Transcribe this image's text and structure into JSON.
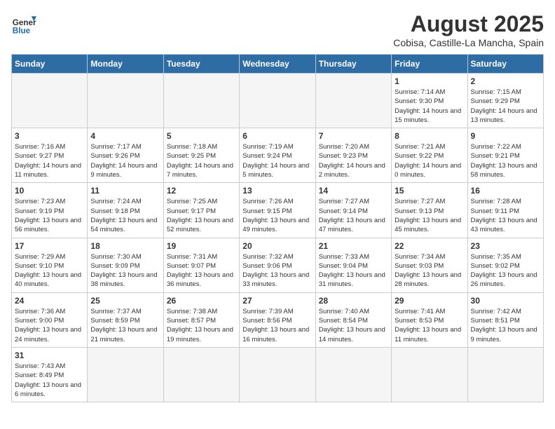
{
  "header": {
    "logo_general": "General",
    "logo_blue": "Blue",
    "month_title": "August 2025",
    "subtitle": "Cobisa, Castille-La Mancha, Spain"
  },
  "weekdays": [
    "Sunday",
    "Monday",
    "Tuesday",
    "Wednesday",
    "Thursday",
    "Friday",
    "Saturday"
  ],
  "weeks": [
    [
      {
        "day": "",
        "info": ""
      },
      {
        "day": "",
        "info": ""
      },
      {
        "day": "",
        "info": ""
      },
      {
        "day": "",
        "info": ""
      },
      {
        "day": "",
        "info": ""
      },
      {
        "day": "1",
        "info": "Sunrise: 7:14 AM\nSunset: 9:30 PM\nDaylight: 14 hours and 15 minutes."
      },
      {
        "day": "2",
        "info": "Sunrise: 7:15 AM\nSunset: 9:29 PM\nDaylight: 14 hours and 13 minutes."
      }
    ],
    [
      {
        "day": "3",
        "info": "Sunrise: 7:16 AM\nSunset: 9:27 PM\nDaylight: 14 hours and 11 minutes."
      },
      {
        "day": "4",
        "info": "Sunrise: 7:17 AM\nSunset: 9:26 PM\nDaylight: 14 hours and 9 minutes."
      },
      {
        "day": "5",
        "info": "Sunrise: 7:18 AM\nSunset: 9:25 PM\nDaylight: 14 hours and 7 minutes."
      },
      {
        "day": "6",
        "info": "Sunrise: 7:19 AM\nSunset: 9:24 PM\nDaylight: 14 hours and 5 minutes."
      },
      {
        "day": "7",
        "info": "Sunrise: 7:20 AM\nSunset: 9:23 PM\nDaylight: 14 hours and 2 minutes."
      },
      {
        "day": "8",
        "info": "Sunrise: 7:21 AM\nSunset: 9:22 PM\nDaylight: 14 hours and 0 minutes."
      },
      {
        "day": "9",
        "info": "Sunrise: 7:22 AM\nSunset: 9:21 PM\nDaylight: 13 hours and 58 minutes."
      }
    ],
    [
      {
        "day": "10",
        "info": "Sunrise: 7:23 AM\nSunset: 9:19 PM\nDaylight: 13 hours and 56 minutes."
      },
      {
        "day": "11",
        "info": "Sunrise: 7:24 AM\nSunset: 9:18 PM\nDaylight: 13 hours and 54 minutes."
      },
      {
        "day": "12",
        "info": "Sunrise: 7:25 AM\nSunset: 9:17 PM\nDaylight: 13 hours and 52 minutes."
      },
      {
        "day": "13",
        "info": "Sunrise: 7:26 AM\nSunset: 9:15 PM\nDaylight: 13 hours and 49 minutes."
      },
      {
        "day": "14",
        "info": "Sunrise: 7:27 AM\nSunset: 9:14 PM\nDaylight: 13 hours and 47 minutes."
      },
      {
        "day": "15",
        "info": "Sunrise: 7:27 AM\nSunset: 9:13 PM\nDaylight: 13 hours and 45 minutes."
      },
      {
        "day": "16",
        "info": "Sunrise: 7:28 AM\nSunset: 9:11 PM\nDaylight: 13 hours and 43 minutes."
      }
    ],
    [
      {
        "day": "17",
        "info": "Sunrise: 7:29 AM\nSunset: 9:10 PM\nDaylight: 13 hours and 40 minutes."
      },
      {
        "day": "18",
        "info": "Sunrise: 7:30 AM\nSunset: 9:09 PM\nDaylight: 13 hours and 38 minutes."
      },
      {
        "day": "19",
        "info": "Sunrise: 7:31 AM\nSunset: 9:07 PM\nDaylight: 13 hours and 36 minutes."
      },
      {
        "day": "20",
        "info": "Sunrise: 7:32 AM\nSunset: 9:06 PM\nDaylight: 13 hours and 33 minutes."
      },
      {
        "day": "21",
        "info": "Sunrise: 7:33 AM\nSunset: 9:04 PM\nDaylight: 13 hours and 31 minutes."
      },
      {
        "day": "22",
        "info": "Sunrise: 7:34 AM\nSunset: 9:03 PM\nDaylight: 13 hours and 28 minutes."
      },
      {
        "day": "23",
        "info": "Sunrise: 7:35 AM\nSunset: 9:02 PM\nDaylight: 13 hours and 26 minutes."
      }
    ],
    [
      {
        "day": "24",
        "info": "Sunrise: 7:36 AM\nSunset: 9:00 PM\nDaylight: 13 hours and 24 minutes."
      },
      {
        "day": "25",
        "info": "Sunrise: 7:37 AM\nSunset: 8:59 PM\nDaylight: 13 hours and 21 minutes."
      },
      {
        "day": "26",
        "info": "Sunrise: 7:38 AM\nSunset: 8:57 PM\nDaylight: 13 hours and 19 minutes."
      },
      {
        "day": "27",
        "info": "Sunrise: 7:39 AM\nSunset: 8:56 PM\nDaylight: 13 hours and 16 minutes."
      },
      {
        "day": "28",
        "info": "Sunrise: 7:40 AM\nSunset: 8:54 PM\nDaylight: 13 hours and 14 minutes."
      },
      {
        "day": "29",
        "info": "Sunrise: 7:41 AM\nSunset: 8:53 PM\nDaylight: 13 hours and 11 minutes."
      },
      {
        "day": "30",
        "info": "Sunrise: 7:42 AM\nSunset: 8:51 PM\nDaylight: 13 hours and 9 minutes."
      }
    ],
    [
      {
        "day": "31",
        "info": "Sunrise: 7:43 AM\nSunset: 8:49 PM\nDaylight: 13 hours and 6 minutes."
      },
      {
        "day": "",
        "info": ""
      },
      {
        "day": "",
        "info": ""
      },
      {
        "day": "",
        "info": ""
      },
      {
        "day": "",
        "info": ""
      },
      {
        "day": "",
        "info": ""
      },
      {
        "day": "",
        "info": ""
      }
    ]
  ]
}
